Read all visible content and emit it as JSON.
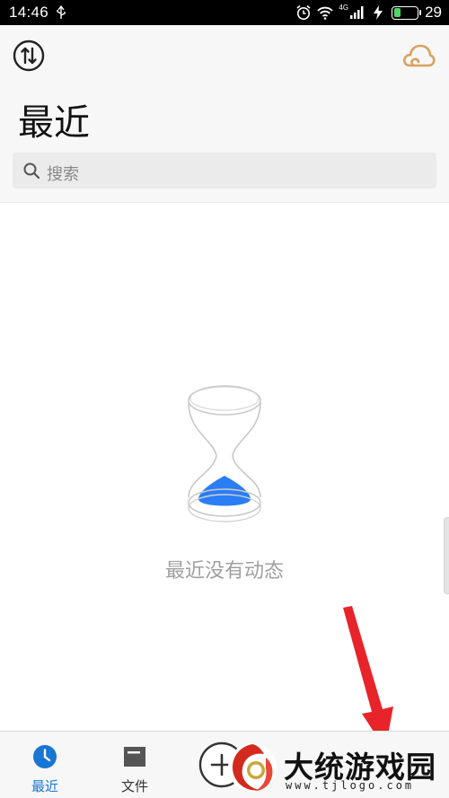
{
  "status_bar": {
    "time": "14:46",
    "network": "4G",
    "battery": "29"
  },
  "header": {
    "title": "最近"
  },
  "search": {
    "placeholder": "搜索"
  },
  "empty_state": {
    "message": "最近没有动态"
  },
  "bottom_nav": {
    "items": [
      {
        "label": "最近",
        "active": true
      },
      {
        "label": "文件",
        "active": false
      }
    ]
  },
  "watermark": {
    "title": "大统游戏园",
    "url": "www.tjlogo.com"
  },
  "colors": {
    "accent": "#1976d2",
    "hourglass_sand": "#2b7df5",
    "cloud": "#d8a25f",
    "annotation": "#e8242b"
  }
}
